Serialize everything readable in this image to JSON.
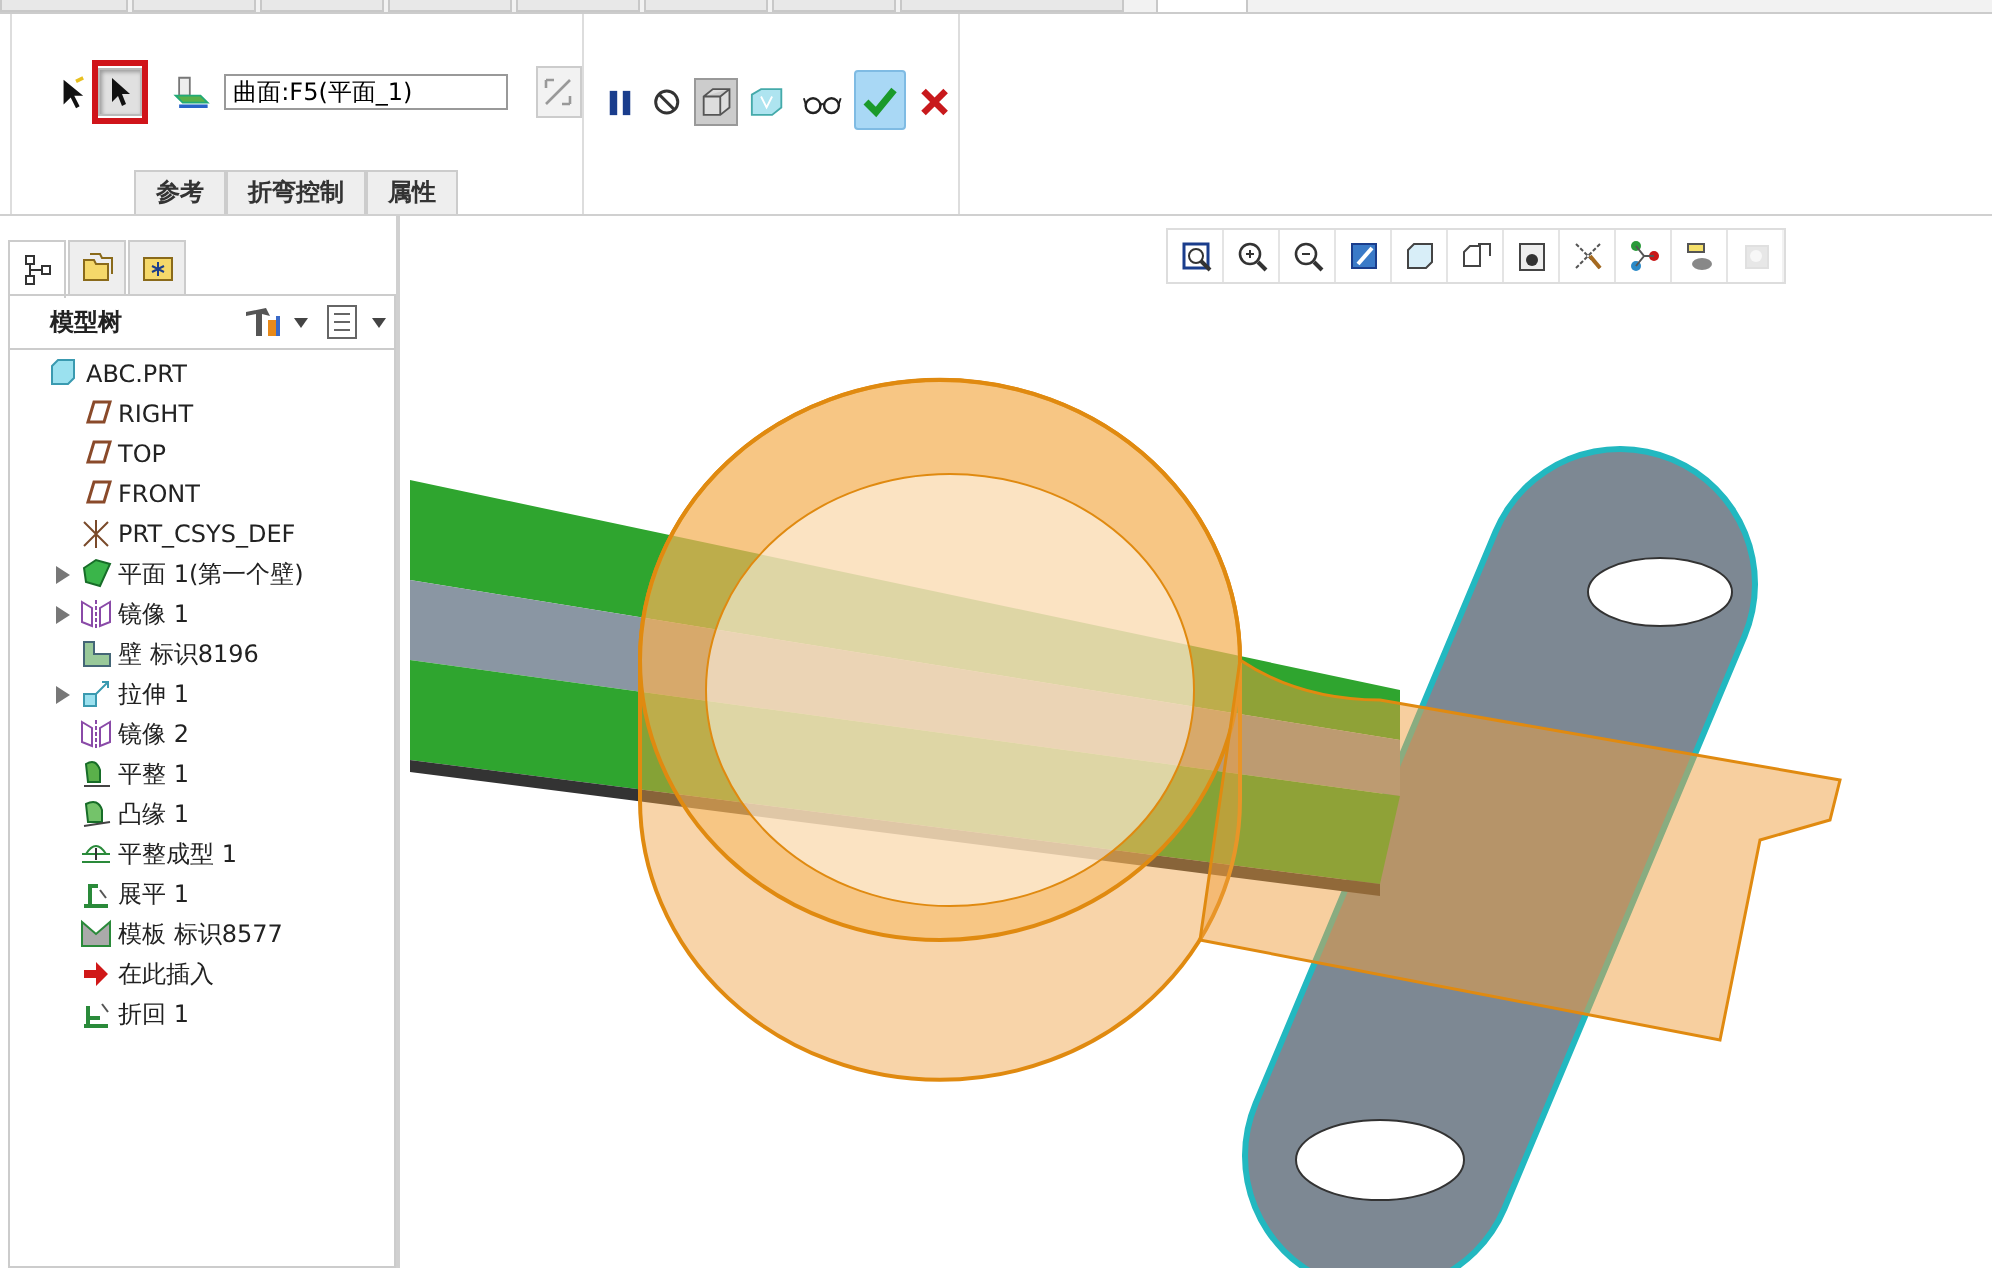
{
  "ribbon_tabs": [
    {
      "selected": false
    },
    {
      "selected": false
    },
    {
      "selected": false
    },
    {
      "selected": false
    },
    {
      "selected": false
    },
    {
      "selected": false
    },
    {
      "selected": false
    },
    {
      "selected": false
    },
    {
      "selected": true
    }
  ],
  "dashboard": {
    "select_button": {
      "pressed": true,
      "highlighted": true
    },
    "reference_field": {
      "value": "曲面:F5(平面_1)"
    },
    "sub_tabs": [
      {
        "label": "参考"
      },
      {
        "label": "折弯控制"
      },
      {
        "label": "属性"
      }
    ],
    "controls": [
      {
        "kind": "pause",
        "pressed": false
      },
      {
        "kind": "stop",
        "pressed": false
      },
      {
        "kind": "preview-box",
        "pressed": true
      },
      {
        "kind": "preview-surface",
        "pressed": false
      },
      {
        "kind": "glasses",
        "pressed": false
      },
      {
        "kind": "ok",
        "pressed": false
      },
      {
        "kind": "cancel",
        "pressed": false
      }
    ]
  },
  "panel_tabs": [
    {
      "kind": "tree",
      "selected": true
    },
    {
      "kind": "folders",
      "selected": false
    },
    {
      "kind": "favorites",
      "selected": false
    }
  ],
  "model_tree": {
    "title": "模型树",
    "items": [
      {
        "label": "ABC.PRT",
        "kind": "part",
        "collapsed": false,
        "children": [
          {
            "label": "RIGHT",
            "kind": "datum-plane",
            "collapsed": false
          },
          {
            "label": "TOP",
            "kind": "datum-plane",
            "collapsed": false
          },
          {
            "label": "FRONT",
            "kind": "datum-plane",
            "collapsed": false
          },
          {
            "label": "PRT_CSYS_DEF",
            "kind": "csys",
            "collapsed": false
          },
          {
            "label": "平面 1(第一个壁)",
            "kind": "flat-wall",
            "collapsed": true
          },
          {
            "label": "镜像 1",
            "kind": "mirror",
            "collapsed": true
          },
          {
            "label": "壁 标识8196",
            "kind": "wall",
            "collapsed": false
          },
          {
            "label": "拉伸 1",
            "kind": "extrude",
            "collapsed": true
          },
          {
            "label": "镜像 2",
            "kind": "mirror",
            "collapsed": false
          },
          {
            "label": "平整 1",
            "kind": "flatten",
            "collapsed": false
          },
          {
            "label": "凸缘 1",
            "kind": "flange",
            "collapsed": false
          },
          {
            "label": "平整成型 1",
            "kind": "form",
            "collapsed": false
          },
          {
            "label": "展平 1",
            "kind": "unbend",
            "collapsed": false
          },
          {
            "label": "模板 标识8577",
            "kind": "template",
            "collapsed": false
          },
          {
            "label": "在此插入",
            "kind": "insert",
            "collapsed": false
          },
          {
            "label": "折回 1",
            "kind": "bend-back",
            "collapsed": false
          }
        ]
      }
    ]
  },
  "view_toolbar": [
    {
      "kind": "zoom-fit",
      "disabled": false
    },
    {
      "kind": "zoom-in",
      "disabled": false
    },
    {
      "kind": "zoom-out",
      "disabled": false
    },
    {
      "kind": "repaint",
      "disabled": false
    },
    {
      "kind": "display-style",
      "disabled": false
    },
    {
      "kind": "saved-views",
      "disabled": false
    },
    {
      "kind": "view-manager",
      "disabled": false
    },
    {
      "kind": "datum-display",
      "disabled": false
    },
    {
      "kind": "spin-center",
      "disabled": false
    },
    {
      "kind": "annotation-display",
      "disabled": false
    },
    {
      "kind": "simulation",
      "disabled": true
    }
  ]
}
